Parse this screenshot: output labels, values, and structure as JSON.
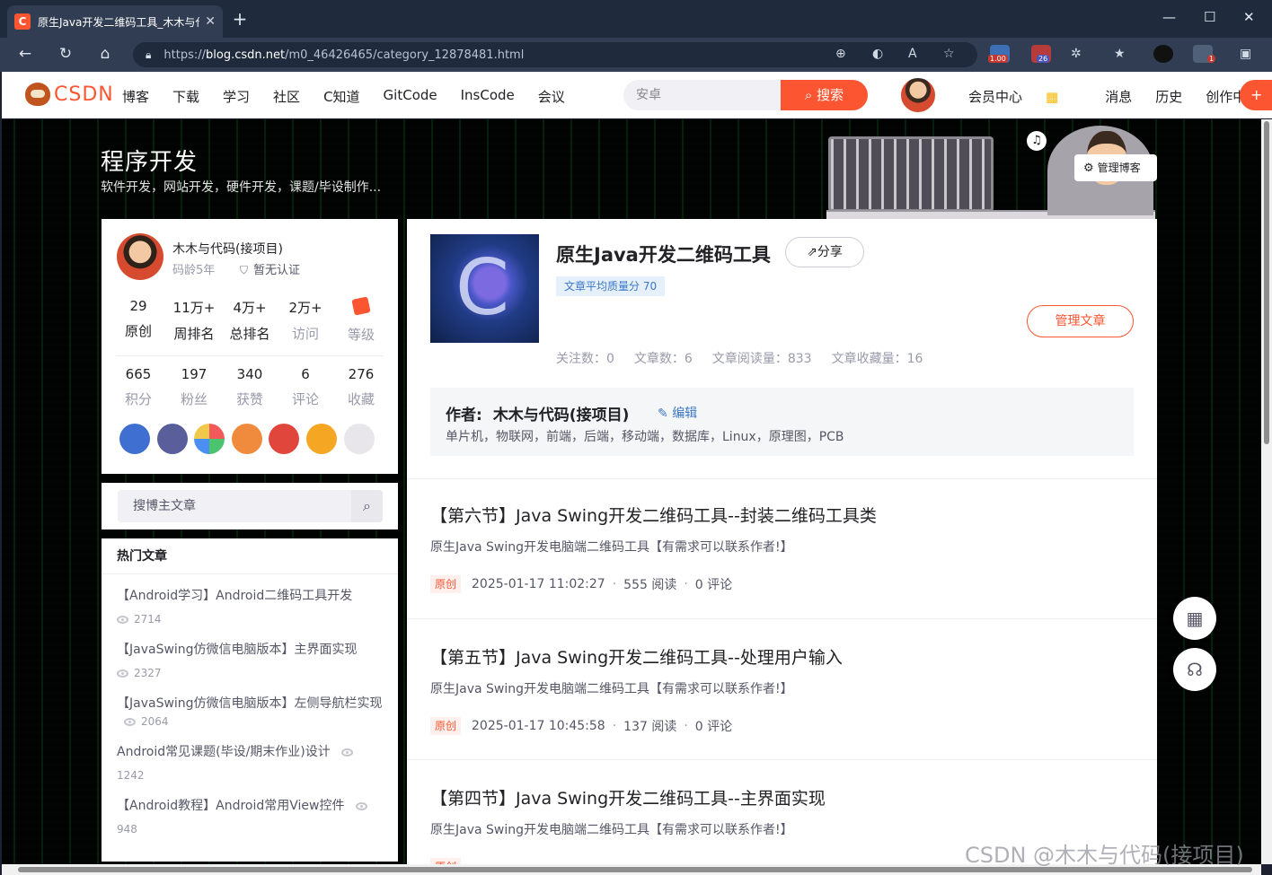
{
  "browser": {
    "tab_title": "原生Java开发二维码工具_木木与代",
    "tab_favicon": "C",
    "url_prefix": "https://",
    "url_domain": "blog.csdn.net",
    "url_path": "/m0_46426465/category_12878481.html",
    "ext_badge_1": "1.00",
    "ext_badge_2": "26",
    "ext_badge_3": "1"
  },
  "csdn_nav": {
    "logo": "CSDN",
    "items": [
      "博客",
      "下载",
      "学习",
      "社区",
      "C知道",
      "GitCode",
      "InsCode",
      "会议"
    ],
    "search_placeholder": "安卓",
    "search_button": "搜索",
    "right_items": [
      "会员中心",
      "消息",
      "历史",
      "创作中心"
    ],
    "accent_color": "#fc5531"
  },
  "banner": {
    "title": "程序开发",
    "subtitle": "软件开发，网站开发，硬件开发，课题/毕设制作...",
    "manage_blog": "管理博客"
  },
  "profile": {
    "name": "木木与代码(接项目)",
    "code_age": "码龄5年",
    "certification": "暂无认证",
    "stats_row1": [
      {
        "value": "29",
        "label": "原创"
      },
      {
        "value": "11万+",
        "label": "周排名"
      },
      {
        "value": "4万+",
        "label": "总排名"
      },
      {
        "value": "2万+",
        "label": "访问"
      },
      {
        "value": "",
        "label": "等级"
      }
    ],
    "stats_row2": [
      {
        "value": "665",
        "label": "积分"
      },
      {
        "value": "197",
        "label": "粉丝"
      },
      {
        "value": "340",
        "label": "获赞"
      },
      {
        "value": "6",
        "label": "评论"
      },
      {
        "value": "276",
        "label": "收藏"
      }
    ]
  },
  "blog_search": {
    "placeholder": "搜博主文章"
  },
  "hot_articles": {
    "header": "热门文章",
    "items": [
      {
        "title": "【Android学习】Android二维码工具开发",
        "views": "2714"
      },
      {
        "title": "【JavaSwing仿微信电脑版本】主界面实现",
        "views": "2327"
      },
      {
        "title": "【JavaSwing仿微信电脑版本】左侧导航栏实现",
        "views": "2064"
      },
      {
        "title": "Android常见课题(毕设/期末作业)设计",
        "views": "1242"
      },
      {
        "title": "【Android教程】Android常用View控件",
        "views": "948"
      }
    ]
  },
  "category": {
    "title": "原生Java开发二维码工具",
    "share": "分享",
    "quality": "文章平均质量分 70",
    "manage": "管理文章",
    "stats": [
      "关注数：0",
      "文章数：6",
      "文章阅读量：833",
      "文章收藏量：16"
    ],
    "author_label": "作者:",
    "author_name": "木木与代码(接项目)",
    "edit": "编辑",
    "tags": "单片机，物联网，前端，后端，移动端，数据库，Linux，原理图，PCB"
  },
  "articles": [
    {
      "title": "【第六节】Java Swing开发二维码工具--封装二维码工具类",
      "desc": "原生Java Swing开发电脑端二维码工具【有需求可以联系作者!】",
      "tag": "原创",
      "date": "2025-01-17 11:02:27",
      "reads": "555 阅读",
      "comments": "0 评论"
    },
    {
      "title": "【第五节】Java Swing开发二维码工具--处理用户输入",
      "desc": "原生Java Swing开发电脑端二维码工具【有需求可以联系作者!】",
      "tag": "原创",
      "date": "2025-01-17 10:45:58",
      "reads": "137 阅读",
      "comments": "0 评论"
    },
    {
      "title": "【第四节】Java Swing开发二维码工具--主界面实现",
      "desc": "原生Java Swing开发电脑端二维码工具【有需求可以联系作者!】",
      "tag": "原创",
      "date": "",
      "reads": "",
      "comments": ""
    }
  ],
  "watermark": "CSDN @木木与代码(接项目)"
}
